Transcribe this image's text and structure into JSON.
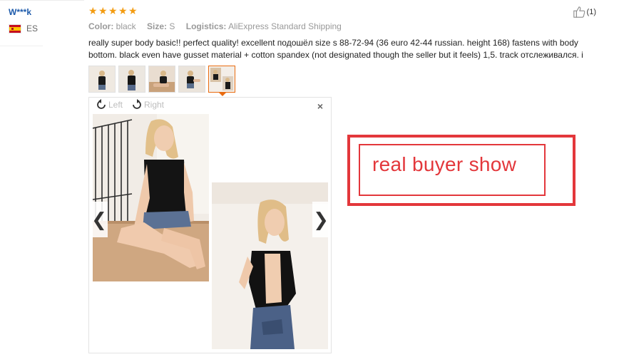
{
  "reviewer": {
    "name": "W***k",
    "country_code": "ES"
  },
  "rating": {
    "stars": 5,
    "icon": "star-icon",
    "color": "#f39c12"
  },
  "helpful": {
    "count": "(1)",
    "icon": "thumbs-up-icon"
  },
  "meta": {
    "color_label": "Color:",
    "color_value": "black",
    "size_label": "Size:",
    "size_value": "S",
    "logistics_label": "Logistics:",
    "logistics_value": "AliExpress Standard Shipping"
  },
  "review_text": "really super body basic!! perfect quality! excellent подошёл size s 88-72-94 (36 euro 42-44 russian. height 168) fastens with body bottom. black even have gusset material + cotton spandex (not designated though the seller but it feels) 1,5. track отслеживался. i",
  "thumbnails": {
    "count": 5,
    "active_index": 4
  },
  "viewer": {
    "rotate_left_label": "Left",
    "rotate_right_label": "Right",
    "close_glyph": "×",
    "prev_glyph": "❮",
    "next_glyph": "❯"
  },
  "callout": {
    "text": "real buyer show",
    "color": "#e3373b"
  },
  "colors": {
    "link": "#1e5bab",
    "accent": "#e96b10",
    "muted": "#999999"
  }
}
